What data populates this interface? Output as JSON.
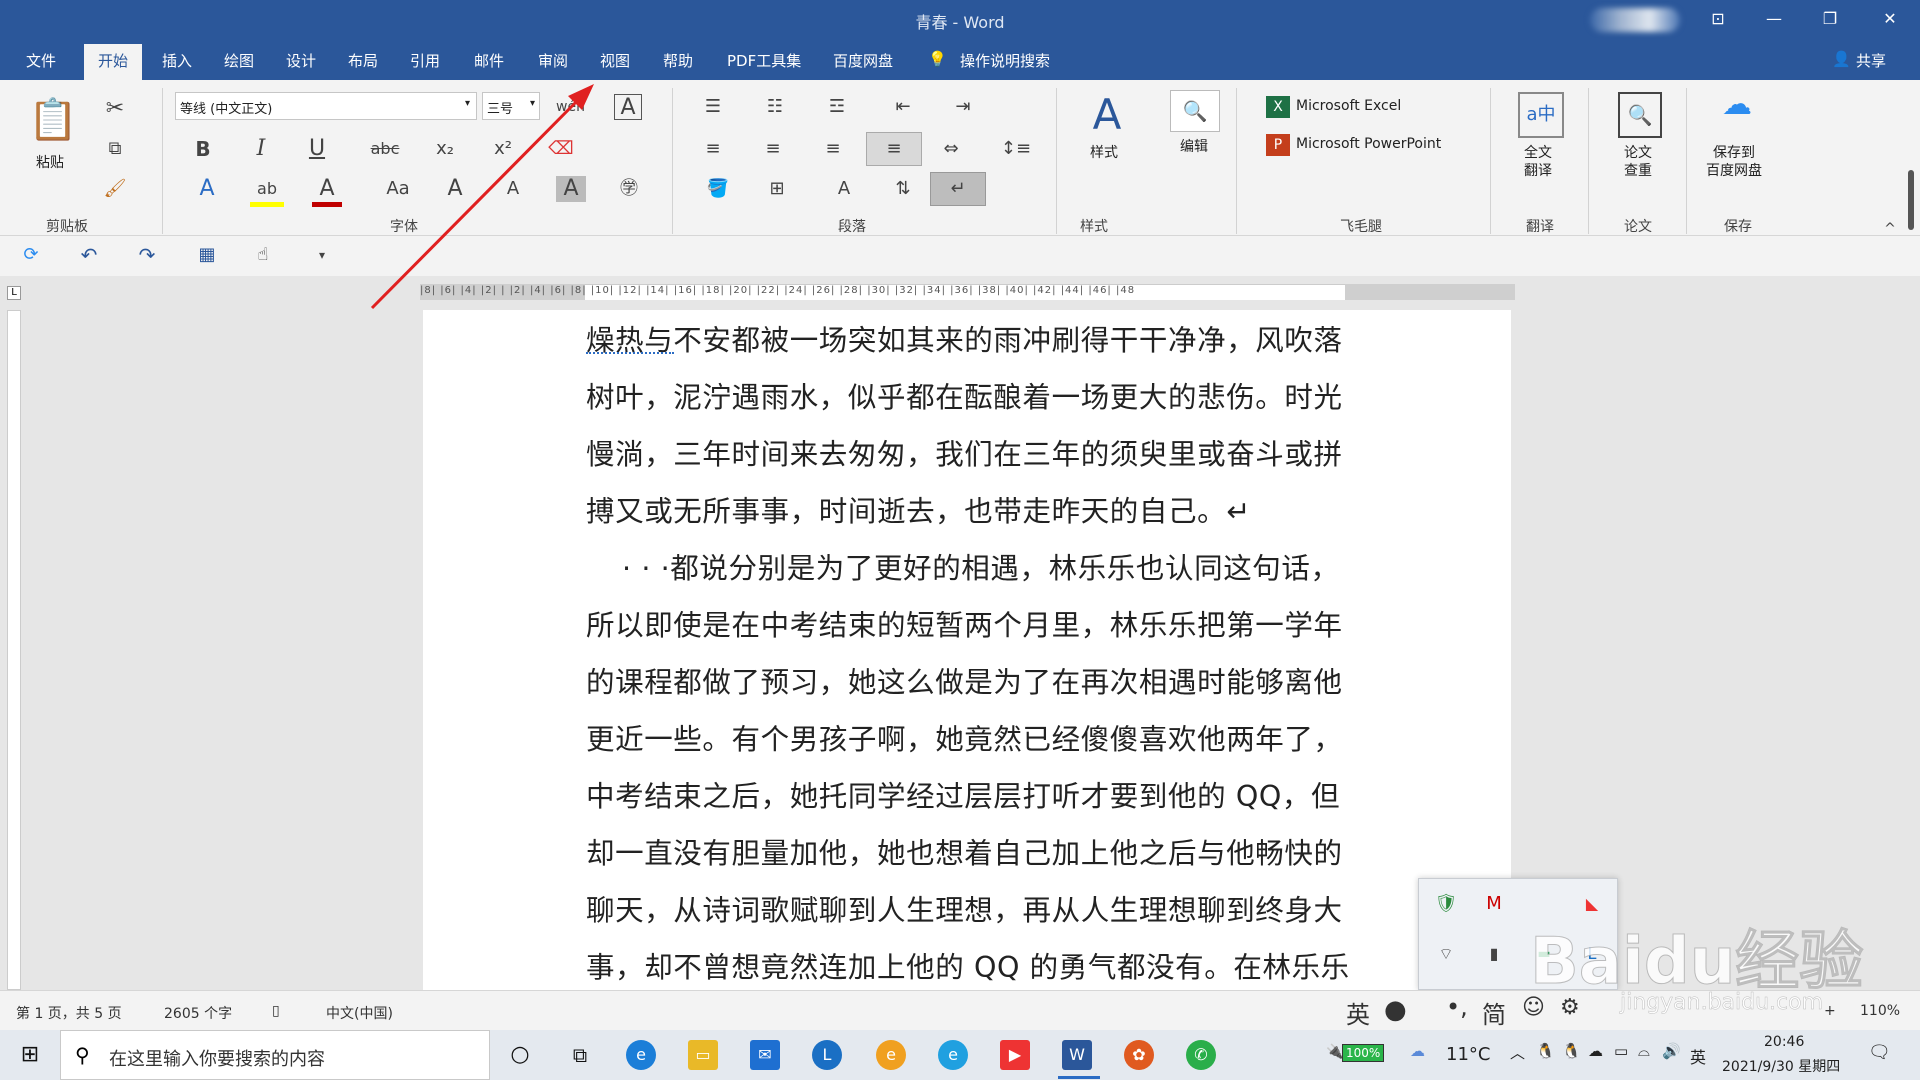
{
  "window": {
    "title": "青春 - Word"
  },
  "tabs": [
    "文件",
    "开始",
    "插入",
    "绘图",
    "设计",
    "布局",
    "引用",
    "邮件",
    "审阅",
    "视图",
    "帮助",
    "PDF工具集",
    "百度网盘"
  ],
  "tell_me": "操作说明搜索",
  "share": "共享",
  "ribbon": {
    "paste": "粘贴",
    "clipboard": "剪贴板",
    "font_name": "等线 (中文正文)",
    "font_size": "三号",
    "font_group": "字体",
    "paragraph_group": "段落",
    "styles_btn": "样式",
    "styles_group": "样式",
    "editing_btn": "编辑",
    "excel": "Microsoft Excel",
    "powerpoint": "Microsoft PowerPoint",
    "feimaotui_group": "飞毛腿",
    "translate_btn": "全文\n翻译",
    "translate_group": "翻译",
    "paper_btn": "论文\n查重",
    "paper_group": "论文",
    "save_btn": "保存到\n百度网盘",
    "save_group": "保存"
  },
  "ruler_text": "|8| |6| |4| |2| |  |2| |4| |6| |8| |10| |12| |14| |16| |18| |20| |22| |24| |26| |28| |30| |32| |34| |36| |38| |40| |42| |44| |46| |48",
  "document": {
    "lines": [
      "燥热与不安都被一场突如其来的雨冲刷得干干净净，风吹落",
      "树叶，泥泞遇雨水，似乎都在酝酿着一场更大的悲伤。时光",
      "慢淌，三年时间来去匆匆，我们在三年的须臾里或奋斗或拼",
      "搏又或无所事事，时间逝去，也带走昨天的自己。↵",
      "· · ·都说分别是为了更好的相遇，林乐乐也认同这句话，",
      "所以即使是在中考结束的短暂两个月里，林乐乐把第一学年",
      "的课程都做了预习，她这么做是为了在再次相遇时能够离他",
      "更近一些。有个男孩子啊，她竟然已经傻傻喜欢他两年了，",
      "中考结束之后，她托同学经过层层打听才要到他的 QQ，但",
      "却一直没有胆量加他，她也想着自己加上他之后与他畅快的",
      "聊天，从诗词歌赋聊到人生理想，再从人生理想聊到终身大",
      "事，却不曾想竟然连加上他的 QQ 的勇气都没有。在林乐乐"
    ]
  },
  "status": {
    "page": "第 1 页，共 5 页",
    "words": "2605 个字",
    "lang": "中文(中国)",
    "zoom": "110%",
    "ime": [
      "英",
      "简"
    ]
  },
  "taskbar": {
    "search_placeholder": "在这里输入你要搜索的内容",
    "battery": "100%",
    "weather": "11°C",
    "ime": "英",
    "time": "20:46",
    "date": "2021/9/30 星期四"
  },
  "watermark": {
    "text": "Baidu经验",
    "url": "jingyan.baidu.com"
  },
  "colors": {
    "word_blue": "#2b579a",
    "annotation_red": "#e02020"
  }
}
